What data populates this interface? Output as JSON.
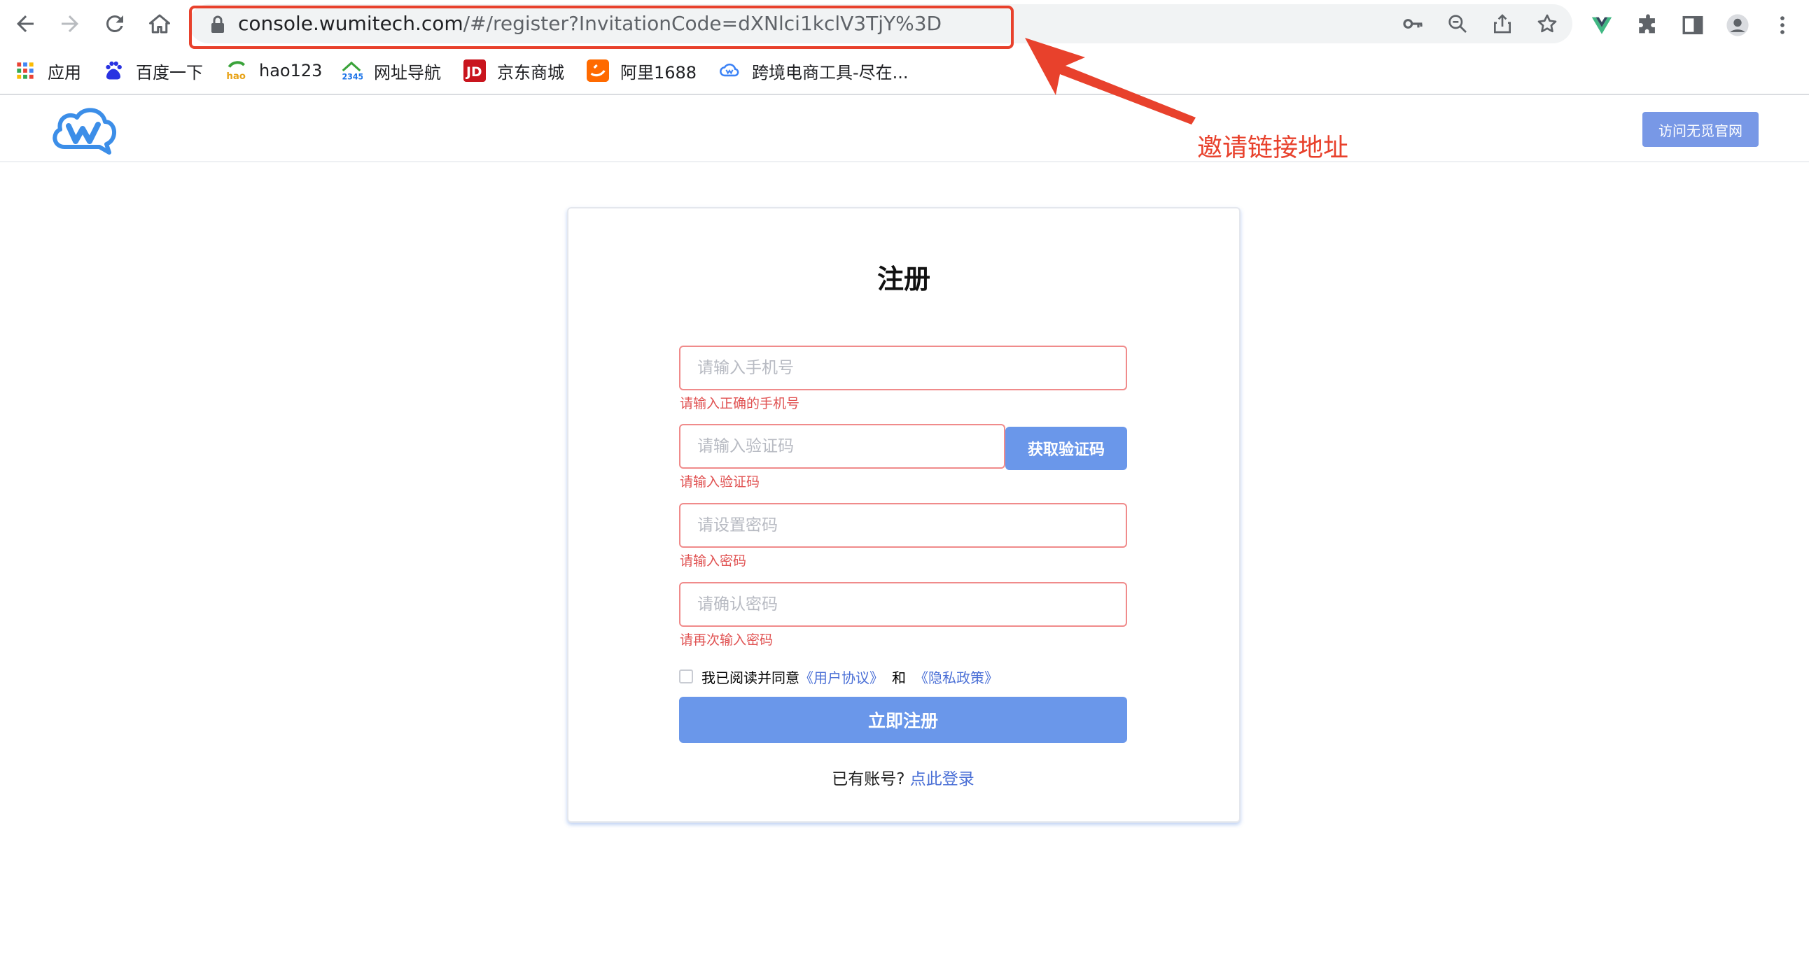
{
  "browser": {
    "url_host": "console.wumitech.com",
    "url_path": "/#/register?InvitationCode=dXNlci1kclV3TjY%3D"
  },
  "bookmarks": [
    {
      "label": "应用",
      "icon": "apps-grid-icon"
    },
    {
      "label": "百度一下",
      "icon": "baidu-icon"
    },
    {
      "label": "hao123",
      "icon": "hao123-icon"
    },
    {
      "label": "网址导航",
      "icon": "2345-icon"
    },
    {
      "label": "京东商城",
      "icon": "jd-icon"
    },
    {
      "label": "阿里1688",
      "icon": "alibaba-icon"
    },
    {
      "label": "跨境电商工具-尽在...",
      "icon": "cloud-icon"
    }
  ],
  "site": {
    "visit_button": "访问无觅官网"
  },
  "annotation": {
    "text": "邀请链接地址",
    "color": "#e8412c"
  },
  "form": {
    "title": "注册",
    "phone": {
      "placeholder": "请输入手机号",
      "error": "请输入正确的手机号"
    },
    "code": {
      "placeholder": "请输入验证码",
      "error": "请输入验证码",
      "button": "获取验证码"
    },
    "password": {
      "placeholder": "请设置密码",
      "error": "请输入密码"
    },
    "confirm": {
      "placeholder": "请确认密码",
      "error": "请再次输入密码"
    },
    "agree": {
      "prefix": "我已阅读并同意",
      "user_agreement": "《用户协议》",
      "and": "和",
      "privacy_policy": "《隐私政策》"
    },
    "submit": "立即注册",
    "login_prompt": "已有账号?",
    "login_link": "点此登录"
  },
  "colors": {
    "primary": "#6a97ea",
    "error": "#e05252",
    "link": "#4a6fd6"
  }
}
